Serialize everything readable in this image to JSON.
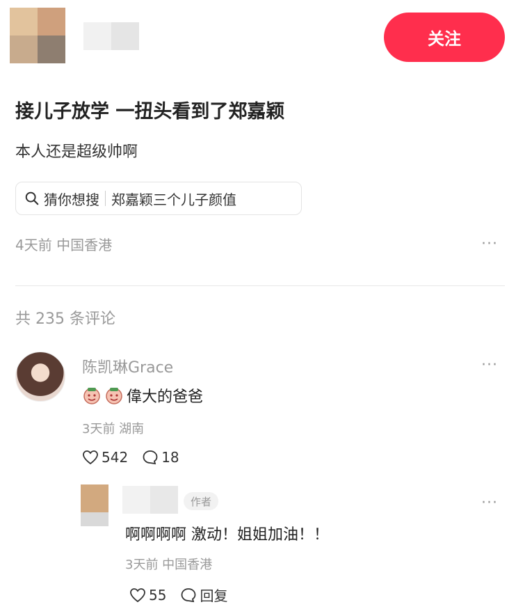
{
  "header": {
    "follow_label": "关注"
  },
  "post": {
    "title": "接儿子放学 一扭头看到了郑嘉颖",
    "desc": "本人还是超级帅啊",
    "search_hint": "猜你想搜",
    "search_keyword": "郑嘉颖三个儿子颜值",
    "meta": "4天前 中国香港",
    "more": "···"
  },
  "comments_count": "共 235 条评论",
  "comment": {
    "user": "陈凯琳Grace",
    "text": "偉大的爸爸",
    "meta": "3天前 湖南",
    "likes": "542",
    "replies": "18",
    "more": "···"
  },
  "reply": {
    "author_tag": "作者",
    "text": "啊啊啊啊 激动！姐姐加油！！",
    "meta": "3天前 中国香港",
    "likes": "55",
    "reply_label": "回复",
    "more": "···"
  },
  "colors": {
    "accent": "#ff2e4d",
    "muted": "#999999"
  },
  "icons": [
    "search-icon",
    "heart-icon",
    "comment-icon",
    "more-icon",
    "emoji-icon"
  ]
}
